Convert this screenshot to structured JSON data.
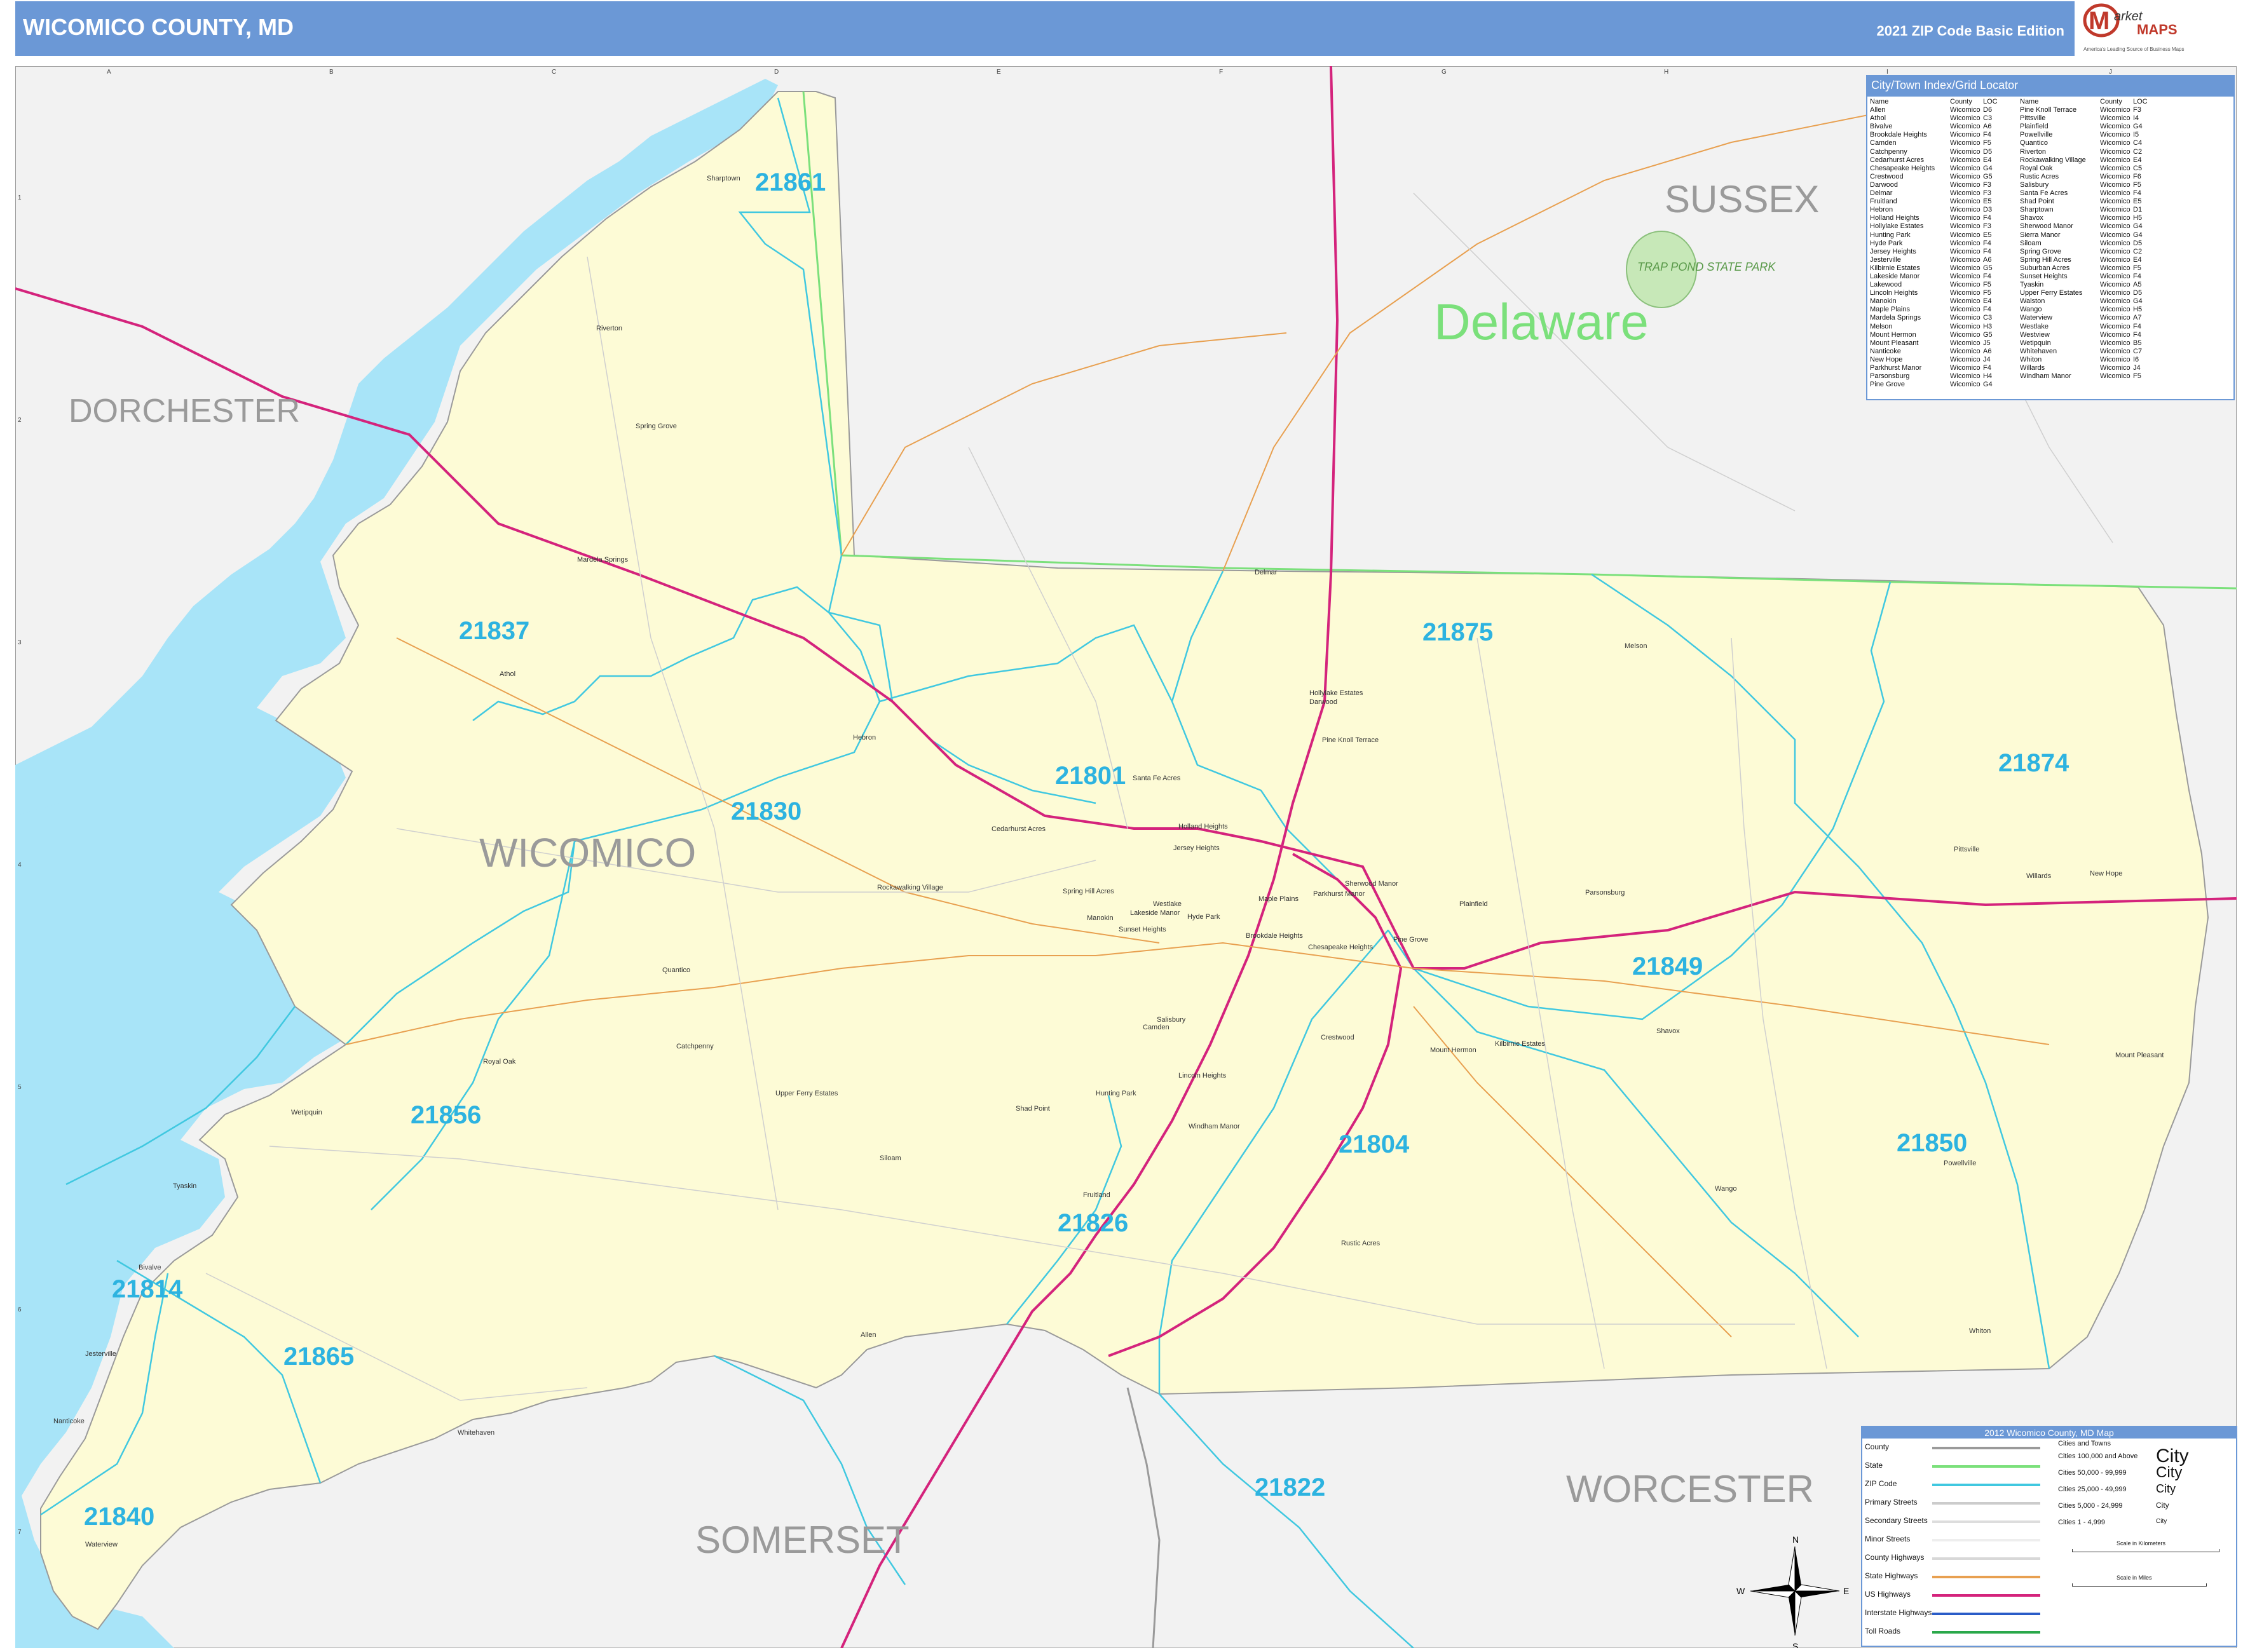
{
  "header": {
    "title": "WICOMICO COUNTY, MD",
    "edition": "2021 ZIP Code Basic Edition",
    "logo_text": "Market MAPS",
    "logo_tagline": "America's Leading Source of Business Maps"
  },
  "grid": {
    "columns": [
      "A",
      "B",
      "C",
      "D",
      "E",
      "F",
      "G",
      "H",
      "I",
      "J"
    ],
    "rows": [
      "1",
      "2",
      "3",
      "4",
      "5",
      "6",
      "7"
    ]
  },
  "region_labels": {
    "sussex": "SUSSEX",
    "delaware": "Delaware",
    "dorchester": "DORCHESTER",
    "wicomico": "WICOMICO",
    "somerset": "SOMERSET",
    "worcester": "WORCESTER",
    "trap_pond": "TRAP POND STATE PARK"
  },
  "zip_labels": [
    "21861",
    "21837",
    "21875",
    "21801",
    "21830",
    "21874",
    "21849",
    "21856",
    "21804",
    "21850",
    "21826",
    "21814",
    "21865",
    "21822",
    "21840"
  ],
  "place_labels": {
    "sharptown": "Sharptown",
    "riverton": "Riverton",
    "spring_grove": "Spring Grove",
    "mardela_springs": "Mardela Springs",
    "athol": "Athol",
    "hebron": "Hebron",
    "delmar": "Delmar",
    "melson": "Melson",
    "hollyvale": "Hollylake Estates",
    "darwood": "Darwood",
    "pine_knoll": "Pine Knoll Terrace",
    "santa_fe": "Santa Fe Acres",
    "cedarhurst": "Cedarhurst Acres",
    "holland": "Holland Heights",
    "jersey": "Jersey Heights",
    "rockawalking": "Rockawalking Village",
    "spring_hill": "Spring Hill Acres",
    "westlake": "Westlake",
    "quantico": "Quantico",
    "pittsville": "Pittsville",
    "willards": "Willards",
    "new_hope": "New Hope",
    "parsonsburg": "Parsonsburg",
    "plainfield": "Plainfield",
    "salisbury": "Salisbury",
    "fruitland": "Fruitland",
    "royal_oak": "Royal Oak",
    "catchpenny": "Catchpenny",
    "upper_ferry": "Upper Ferry Estates",
    "webquin": "Wetipquin",
    "tyaskin": "Tyaskin",
    "bivalve": "Bivalve",
    "jesterville": "Jesterville",
    "nanticoke": "Nanticoke",
    "whitehaven": "Whitehaven",
    "waterview": "Waterview",
    "siloam": "Siloam",
    "allen": "Allen",
    "shavox": "Shavox",
    "mount_hermon": "Mount Hermon",
    "kilbirnie": "Kilbirnie Estates",
    "mount_pleasant": "Mount Pleasant",
    "powellville": "Powellville",
    "wango": "Wango",
    "whiton": "Whiton",
    "rustic_acres": "Rustic Acres",
    "windham": "Windham Manor",
    "hunting_park": "Hunting Park",
    "crestwood": "Crestwood",
    "lincoln": "Lincoln Heights",
    "camden": "Camden",
    "lakewood": "Lakewood",
    "shad_point": "Shad Point",
    "brookdale": "Brookdale Heights",
    "parkhurst": "Parkhurst Manor",
    "sherwood": "Sherwood Manor",
    "chesapeake": "Chesapeake Heights",
    "pine_grove": "Pine Grove",
    "hyde_park": "Hyde Park",
    "lakeside": "Lakeside Manor",
    "maple_plains": "Maple Plains",
    "sunset": "Sunset Heights",
    "manokin": "Manokin",
    "meltyn": "Westlake"
  },
  "index": {
    "title": "City/Town Index/Grid Locator",
    "headers": {
      "name": "Name",
      "county": "County",
      "loc": "LOC"
    },
    "left": [
      [
        "Allen",
        "Wicomico",
        "D6"
      ],
      [
        "Athol",
        "Wicomico",
        "C3"
      ],
      [
        "Bivalve",
        "Wicomico",
        "A6"
      ],
      [
        "Brookdale Heights",
        "Wicomico",
        "F4"
      ],
      [
        "Camden",
        "Wicomico",
        "F5"
      ],
      [
        "Catchpenny",
        "Wicomico",
        "D5"
      ],
      [
        "Cedarhurst Acres",
        "Wicomico",
        "E4"
      ],
      [
        "Chesapeake Heights",
        "Wicomico",
        "G4"
      ],
      [
        "Crestwood",
        "Wicomico",
        "G5"
      ],
      [
        "Darwood",
        "Wicomico",
        "F3"
      ],
      [
        "Delmar",
        "Wicomico",
        "F3"
      ],
      [
        "Fruitland",
        "Wicomico",
        "E5"
      ],
      [
        "Hebron",
        "Wicomico",
        "D3"
      ],
      [
        "Holland Heights",
        "Wicomico",
        "F4"
      ],
      [
        "Hollylake Estates",
        "Wicomico",
        "F3"
      ],
      [
        "Hunting Park",
        "Wicomico",
        "E5"
      ],
      [
        "Hyde Park",
        "Wicomico",
        "F4"
      ],
      [
        "Jersey Heights",
        "Wicomico",
        "F4"
      ],
      [
        "Jesterville",
        "Wicomico",
        "A6"
      ],
      [
        "Kilbirnie Estates",
        "Wicomico",
        "G5"
      ],
      [
        "Lakeside Manor",
        "Wicomico",
        "F4"
      ],
      [
        "Lakewood",
        "Wicomico",
        "F5"
      ],
      [
        "Lincoln Heights",
        "Wicomico",
        "F5"
      ],
      [
        "Manokin",
        "Wicomico",
        "E4"
      ],
      [
        "Maple Plains",
        "Wicomico",
        "F4"
      ],
      [
        "Mardela Springs",
        "Wicomico",
        "C3"
      ],
      [
        "Melson",
        "Wicomico",
        "H3"
      ],
      [
        "Mount Hermon",
        "Wicomico",
        "G5"
      ],
      [
        "Mount Pleasant",
        "Wicomico",
        "J5"
      ],
      [
        "Nanticoke",
        "Wicomico",
        "A6"
      ],
      [
        "New Hope",
        "Wicomico",
        "J4"
      ],
      [
        "Parkhurst Manor",
        "Wicomico",
        "F4"
      ],
      [
        "Parsonsburg",
        "Wicomico",
        "H4"
      ],
      [
        "Pine Grove",
        "Wicomico",
        "G4"
      ]
    ],
    "right": [
      [
        "Pine Knoll Terrace",
        "Wicomico",
        "F3"
      ],
      [
        "Pittsville",
        "Wicomico",
        "I4"
      ],
      [
        "Plainfield",
        "Wicomico",
        "G4"
      ],
      [
        "Powellville",
        "Wicomico",
        "I5"
      ],
      [
        "Quantico",
        "Wicomico",
        "C4"
      ],
      [
        "Riverton",
        "Wicomico",
        "C2"
      ],
      [
        "Rockawalking Village",
        "Wicomico",
        "E4"
      ],
      [
        "Royal Oak",
        "Wicomico",
        "C5"
      ],
      [
        "Rustic Acres",
        "Wicomico",
        "F6"
      ],
      [
        "Salisbury",
        "Wicomico",
        "F5"
      ],
      [
        "Santa Fe Acres",
        "Wicomico",
        "F4"
      ],
      [
        "Shad Point",
        "Wicomico",
        "E5"
      ],
      [
        "Sharptown",
        "Wicomico",
        "D1"
      ],
      [
        "Shavox",
        "Wicomico",
        "H5"
      ],
      [
        "Sherwood Manor",
        "Wicomico",
        "G4"
      ],
      [
        "Sierra Manor",
        "Wicomico",
        "G4"
      ],
      [
        "Siloam",
        "Wicomico",
        "D5"
      ],
      [
        "Spring Grove",
        "Wicomico",
        "C2"
      ],
      [
        "Spring Hill Acres",
        "Wicomico",
        "E4"
      ],
      [
        "Suburban Acres",
        "Wicomico",
        "F5"
      ],
      [
        "Sunset Heights",
        "Wicomico",
        "F4"
      ],
      [
        "Tyaskin",
        "Wicomico",
        "A5"
      ],
      [
        "Upper Ferry Estates",
        "Wicomico",
        "D5"
      ],
      [
        "Walston",
        "Wicomico",
        "G4"
      ],
      [
        "Wango",
        "Wicomico",
        "H5"
      ],
      [
        "Waterview",
        "Wicomico",
        "A7"
      ],
      [
        "Westlake",
        "Wicomico",
        "F4"
      ],
      [
        "Westview",
        "Wicomico",
        "F4"
      ],
      [
        "Wetipquin",
        "Wicomico",
        "B5"
      ],
      [
        "Whitehaven",
        "Wicomico",
        "C7"
      ],
      [
        "Whiton",
        "Wicomico",
        "I6"
      ],
      [
        "Willards",
        "Wicomico",
        "J4"
      ],
      [
        "Windham Manor",
        "Wicomico",
        "F5"
      ]
    ]
  },
  "legend": {
    "title": "2012 Wicomico County, MD Map",
    "items": [
      {
        "label": "County",
        "color": "#9a9a9a"
      },
      {
        "label": "State",
        "color": "#7be07b"
      },
      {
        "label": "ZIP Code",
        "color": "#40c8e0"
      },
      {
        "label": "Primary Streets",
        "color": "#cccccc"
      },
      {
        "label": "Secondary Streets",
        "color": "#dddddd"
      },
      {
        "label": "Minor Streets",
        "color": "#eeeeee"
      },
      {
        "label": "County Highways",
        "color": "#d8d8d8"
      },
      {
        "label": "State Highways",
        "color": "#e8a050"
      },
      {
        "label": "US Highways",
        "color": "#d4237c"
      },
      {
        "label": "Interstate Highways",
        "color": "#2a5cc8"
      },
      {
        "label": "Toll Roads",
        "color": "#2aa84a"
      }
    ],
    "cities_title": "Cities and Towns",
    "city_sizes": [
      "Cities 100,000 and Above",
      "Cities 50,000 - 99,999",
      "Cities 25,000 - 49,999",
      "Cities 5,000 - 24,999",
      "Cities 1 - 4,999"
    ],
    "city_word": "City",
    "scale_km": "Scale in Kilometers",
    "scale_mi": "Scale in Miles"
  },
  "compass": {
    "n": "N",
    "s": "S",
    "e": "E",
    "w": "W"
  },
  "colors": {
    "water": "#a8e4f8",
    "county_fill": "#fdfbd6",
    "outside": "#f2f2f2",
    "zip": "#40c8e0",
    "us_hwy": "#d4237c",
    "state_hwy": "#e8a050"
  }
}
